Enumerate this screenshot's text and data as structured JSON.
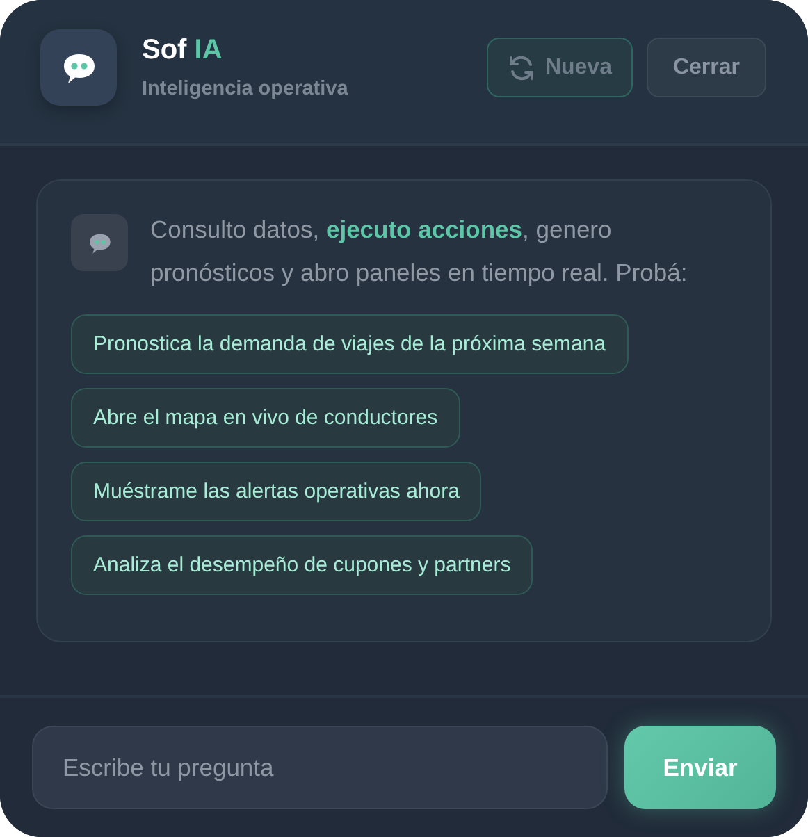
{
  "header": {
    "title": "Sof",
    "title_accent": "IA",
    "subtitle": "Inteligencia operativa",
    "buttons": [
      {
        "kind": "new",
        "label": "Nueva"
      },
      {
        "kind": "close",
        "label": "Cerrar"
      }
    ]
  },
  "message": {
    "text": "Consulto datos, **ejecuto acciones**, genero pronósticos y abro paneles en tiempo real. Probá:",
    "suggestions": [
      "Pronostica la demanda de viajes de la próxima semana",
      "Abre el mapa en vivo de conductores",
      "Muéstrame las alertas operativas ahora",
      "Analiza el desempeño de cupones y partners"
    ]
  },
  "composer": {
    "placeholder": "Escribe tu pregunta",
    "send": "Enviar"
  }
}
